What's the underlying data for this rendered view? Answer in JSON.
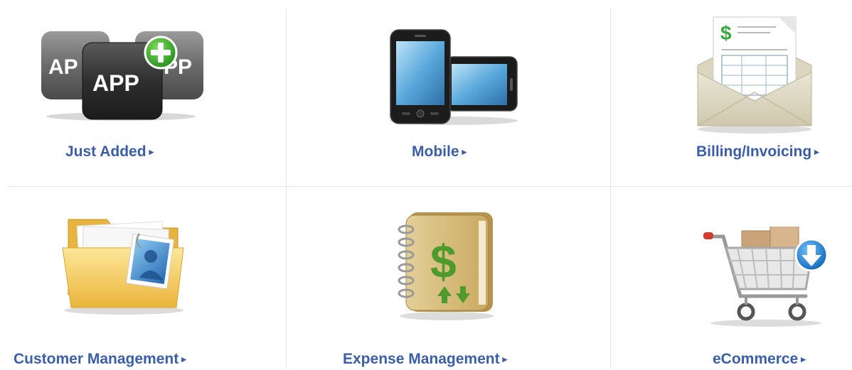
{
  "categories": [
    {
      "label": "Just Added",
      "arrow": "▸",
      "icon": "app-plus-icon"
    },
    {
      "label": "Mobile",
      "arrow": "▸",
      "icon": "mobile-phone-icon"
    },
    {
      "label": "Billing/Invoicing",
      "arrow": "▸",
      "icon": "invoice-envelope-icon"
    },
    {
      "label": "Customer Management",
      "arrow": "▸",
      "icon": "customer-folder-icon"
    },
    {
      "label": "Expense Management",
      "arrow": "▸",
      "icon": "expense-book-icon"
    },
    {
      "label": "eCommerce",
      "arrow": "▸",
      "icon": "shopping-cart-icon"
    }
  ],
  "icon_text": {
    "app": "APP",
    "app_left": "AP",
    "app_right": "PP"
  },
  "colors": {
    "link": "#3b5eab",
    "divider": "#e6e6e6",
    "green_plus": "#35a52c",
    "download_blue": "#1f86d6"
  }
}
